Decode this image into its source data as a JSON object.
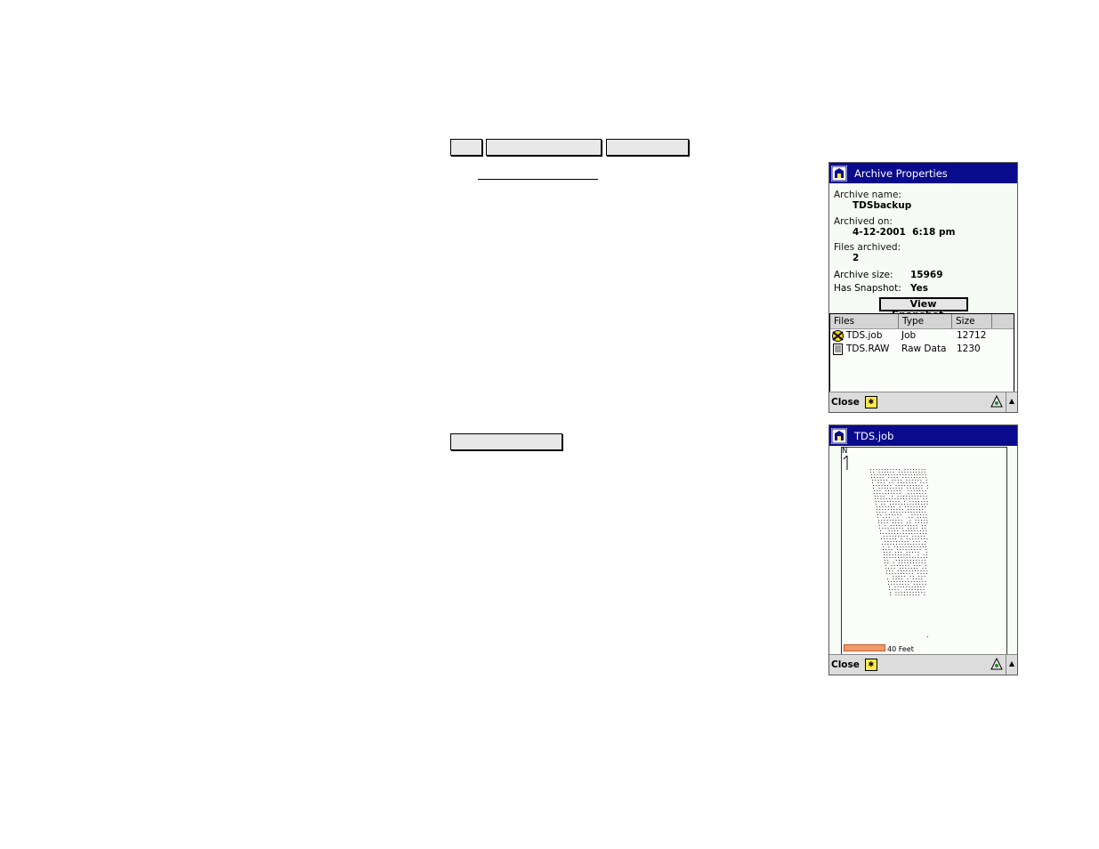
{
  "archive_window": {
    "title": "Archive Properties",
    "archive_name_label": "Archive name:",
    "archive_name": "TDSbackup",
    "archived_on_label": "Archived on:",
    "archived_on": "4-12-2001  6:18 pm",
    "files_archived_label": "Files archived:",
    "files_archived": "2",
    "archive_size_label": "Archive size:",
    "archive_size": "15969",
    "has_snapshot_label": "Has Snapshot:",
    "has_snapshot": "Yes",
    "view_snapshot_button": "View Snapshot...",
    "columns": [
      "Files",
      "Type",
      "Size"
    ],
    "files": [
      {
        "name": "TDS.job",
        "type": "Job",
        "size": "12712",
        "icon": "job-file-icon"
      },
      {
        "name": "TDS.RAW",
        "type": "Raw Data",
        "size": "1230",
        "icon": "raw-data-file-icon"
      }
    ],
    "close_label": "Close"
  },
  "snapshot_window": {
    "title": "TDS.job",
    "north_label": "N",
    "scale_label": "40 Feet",
    "close_label": "Close"
  },
  "colors": {
    "titlebar": "#0a0a8c",
    "window_bg": "#f6fbf6",
    "scale_bar": "#f09a6a"
  }
}
